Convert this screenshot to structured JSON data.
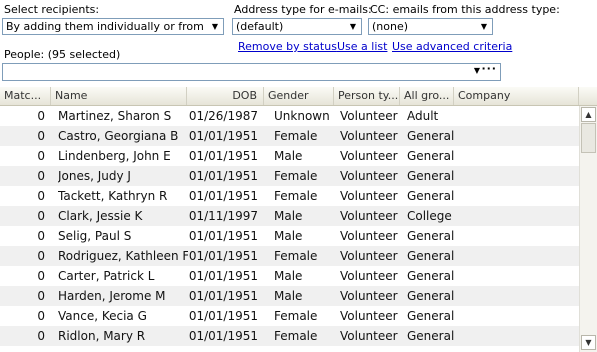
{
  "recipients": {
    "label": "Select recipients:",
    "value": "By adding them individually or from lists"
  },
  "address_type": {
    "label": "Address type for e-mails:",
    "value": "(default)"
  },
  "cc": {
    "label": "CC: emails from this address type:",
    "value": "(none)"
  },
  "links": {
    "remove_by_status": "Remove by status",
    "use_a_list": "Use a list",
    "use_advanced_criteria": "Use advanced criteria"
  },
  "people": {
    "label": "People: (95 selected)",
    "more_button": "···"
  },
  "columns": [
    "Matc...",
    "Name",
    "DOB",
    "Gender",
    "Person ty...",
    "All gro...",
    "Company"
  ],
  "rows": [
    {
      "match": "0",
      "name": "Martinez, Sharon S",
      "dob": "01/26/1987",
      "gender": "Unknown",
      "type": "Volunteer",
      "group": "Adult",
      "company": ""
    },
    {
      "match": "0",
      "name": "Castro, Georgiana B",
      "dob": "01/01/1951",
      "gender": "Female",
      "type": "Volunteer",
      "group": "General",
      "company": ""
    },
    {
      "match": "0",
      "name": "Lindenberg, John E",
      "dob": "01/01/1951",
      "gender": "Male",
      "type": "Volunteer",
      "group": "General",
      "company": ""
    },
    {
      "match": "0",
      "name": "Jones, Judy J",
      "dob": "01/01/1951",
      "gender": "Female",
      "type": "Volunteer",
      "group": "General",
      "company": ""
    },
    {
      "match": "0",
      "name": "Tackett, Kathryn R",
      "dob": "01/01/1951",
      "gender": "Female",
      "type": "Volunteer",
      "group": "General",
      "company": ""
    },
    {
      "match": "0",
      "name": "Clark, Jessie K",
      "dob": "01/11/1997",
      "gender": "Male",
      "type": "Volunteer",
      "group": "College",
      "company": ""
    },
    {
      "match": "0",
      "name": "Selig, Paul S",
      "dob": "01/01/1951",
      "gender": "Male",
      "type": "Volunteer",
      "group": "General",
      "company": ""
    },
    {
      "match": "0",
      "name": "Rodriguez, Kathleen F",
      "dob": "01/01/1951",
      "gender": "Female",
      "type": "Volunteer",
      "group": "General",
      "company": ""
    },
    {
      "match": "0",
      "name": "Carter, Patrick L",
      "dob": "01/01/1951",
      "gender": "Male",
      "type": "Volunteer",
      "group": "General",
      "company": ""
    },
    {
      "match": "0",
      "name": "Harden, Jerome M",
      "dob": "01/01/1951",
      "gender": "Male",
      "type": "Volunteer",
      "group": "General",
      "company": ""
    },
    {
      "match": "0",
      "name": "Vance, Kecia G",
      "dob": "01/01/1951",
      "gender": "Female",
      "type": "Volunteer",
      "group": "General",
      "company": ""
    },
    {
      "match": "0",
      "name": "Ridlon, Mary R",
      "dob": "01/01/1951",
      "gender": "Female",
      "type": "Volunteer",
      "group": "General",
      "company": ""
    }
  ],
  "colors": {
    "link": "#0000cc",
    "field_border": "#7f9db9",
    "header_bg": "#e6e4d8",
    "alt_row": "#f0f0f0"
  },
  "icons": {
    "dropdown": "chevron-down-icon",
    "scroll_up": "scroll-up-icon",
    "scroll_down": "scroll-down-icon"
  }
}
